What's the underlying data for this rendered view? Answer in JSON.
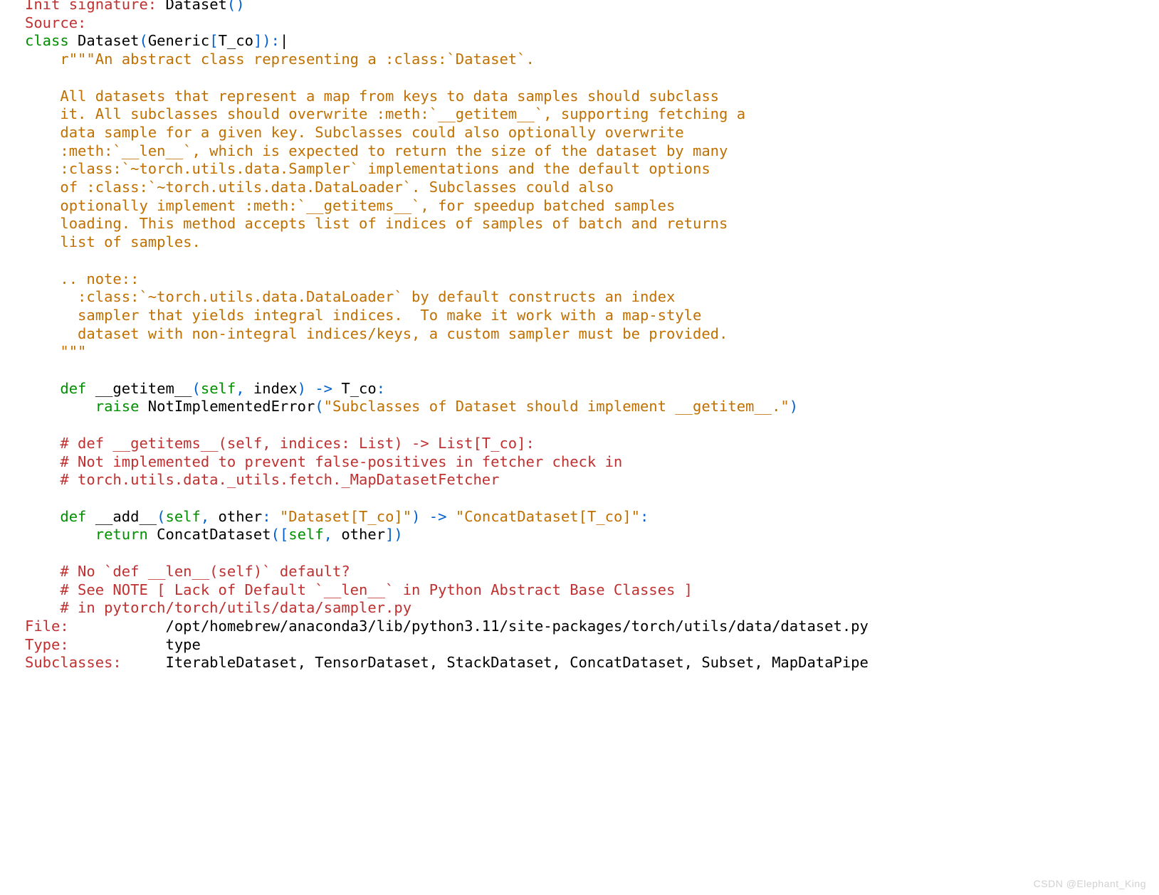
{
  "colors": {
    "red": "#bf3030",
    "blue": "#005fcf",
    "green": "#008f00",
    "orange": "#c07000",
    "black": "#000000"
  },
  "header": {
    "init_sig_label": "Init signature:",
    "init_sig_name": " Dataset",
    "init_sig_parens": "()",
    "source_label": "Source:"
  },
  "class_decl": {
    "kw_class": "class",
    "name": " Dataset",
    "open": "(",
    "generic": "Generic",
    "bracket_open": "[",
    "type_param": "T_co",
    "bracket_close": "]",
    "close": "):",
    "cursor": "|"
  },
  "docstring": {
    "l01": "    r\"\"\"An abstract class representing a :class:`Dataset`.",
    "l02": "",
    "l03": "    All datasets that represent a map from keys to data samples should subclass",
    "l04": "    it. All subclasses should overwrite :meth:`__getitem__`, supporting fetching a",
    "l05": "    data sample for a given key. Subclasses could also optionally overwrite",
    "l06": "    :meth:`__len__`, which is expected to return the size of the dataset by many",
    "l07": "    :class:`~torch.utils.data.Sampler` implementations and the default options",
    "l08": "    of :class:`~torch.utils.data.DataLoader`. Subclasses could also",
    "l09": "    optionally implement :meth:`__getitems__`, for speedup batched samples",
    "l10": "    loading. This method accepts list of indices of samples of batch and returns",
    "l11": "    list of samples.",
    "l12": "",
    "l13": "    .. note::",
    "l14": "      :class:`~torch.utils.data.DataLoader` by default constructs an index",
    "l15": "      sampler that yields integral indices.  To make it work with a map-style",
    "l16": "      dataset with non-integral indices/keys, a custom sampler must be provided.",
    "l17": "    \"\"\""
  },
  "getitem": {
    "kw_def": "    def",
    "name": " __getitem__",
    "open": "(",
    "self": "self",
    "comma": ",",
    "arg": " index",
    "close_paren": ")",
    "arrow": " ->",
    "ret": " T_co",
    "colon": ":",
    "kw_raise": "        raise",
    "exc": " NotImplementedError",
    "exc_open": "(",
    "msg": "\"Subclasses of Dataset should implement __getitem__.\"",
    "exc_close": ")"
  },
  "comments_a": {
    "c1": "    # def __getitems__(self, indices: List) -> List[T_co]:",
    "c2": "    # Not implemented to prevent false-positives in fetcher check in",
    "c3": "    # torch.utils.data._utils.fetch._MapDatasetFetcher"
  },
  "add": {
    "kw_def": "    def",
    "name": " __add__",
    "open": "(",
    "self": "self",
    "comma": ",",
    "other": " other",
    "colon_ann": ":",
    "ann": " \"Dataset[T_co]\"",
    "close_paren": ")",
    "arrow": " ->",
    "ret": " \"ConcatDataset[T_co]\"",
    "end_colon": ":",
    "kw_return": "        return",
    "call": " ConcatDataset",
    "call_open": "(",
    "list_open": "[",
    "list_self": "self",
    "list_comma": ",",
    "list_other": " other",
    "list_close": "]",
    "call_close": ")"
  },
  "comments_b": {
    "c1": "    # No `def __len__(self)` default?",
    "c2": "    # See NOTE [ Lack of Default `__len__` in Python Abstract Base Classes ]",
    "c3": "    # in pytorch/torch/utils/data/sampler.py"
  },
  "footer": {
    "file_label": "File:",
    "file_value": "           /opt/homebrew/anaconda3/lib/python3.11/site-packages/torch/utils/data/dataset.py",
    "type_label": "Type:",
    "type_value": "           type",
    "sub_label": "Subclasses:",
    "sub_value": "     IterableDataset, TensorDataset, StackDataset, ConcatDataset, Subset, MapDataPipe"
  },
  "watermark": "CSDN @Elephant_King"
}
